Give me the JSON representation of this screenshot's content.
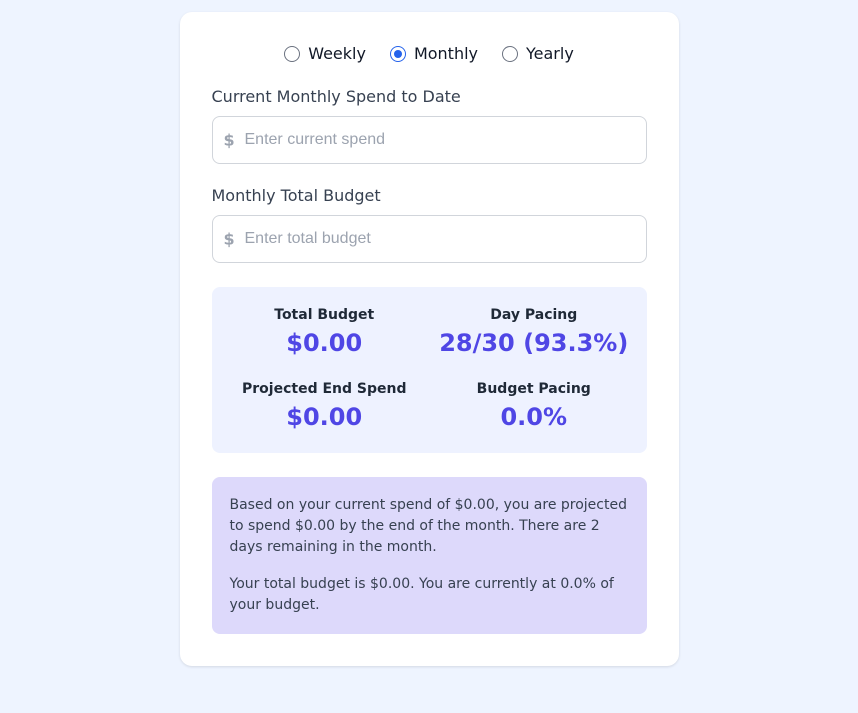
{
  "period": {
    "weekly": "Weekly",
    "monthly": "Monthly",
    "yearly": "Yearly",
    "selected": "monthly"
  },
  "fields": {
    "currentSpend": {
      "label": "Current Monthly Spend to Date",
      "placeholder": "Enter current spend",
      "value": ""
    },
    "totalBudget": {
      "label": "Monthly Total Budget",
      "placeholder": "Enter total budget",
      "value": ""
    }
  },
  "stats": {
    "totalBudget": {
      "label": "Total Budget",
      "value": "$0.00"
    },
    "dayPacing": {
      "label": "Day Pacing",
      "value": "28/30 (93.3%)"
    },
    "projectedEndSpend": {
      "label": "Projected End Spend",
      "value": "$0.00"
    },
    "budgetPacing": {
      "label": "Budget Pacing",
      "value": "0.0%"
    }
  },
  "summary": {
    "line1": "Based on your current spend of $0.00, you are projected to spend $0.00 by the end of the month. There are 2 days remaining in the month.",
    "line2": "Your total budget is $0.00. You are currently at 0.0% of your budget."
  }
}
